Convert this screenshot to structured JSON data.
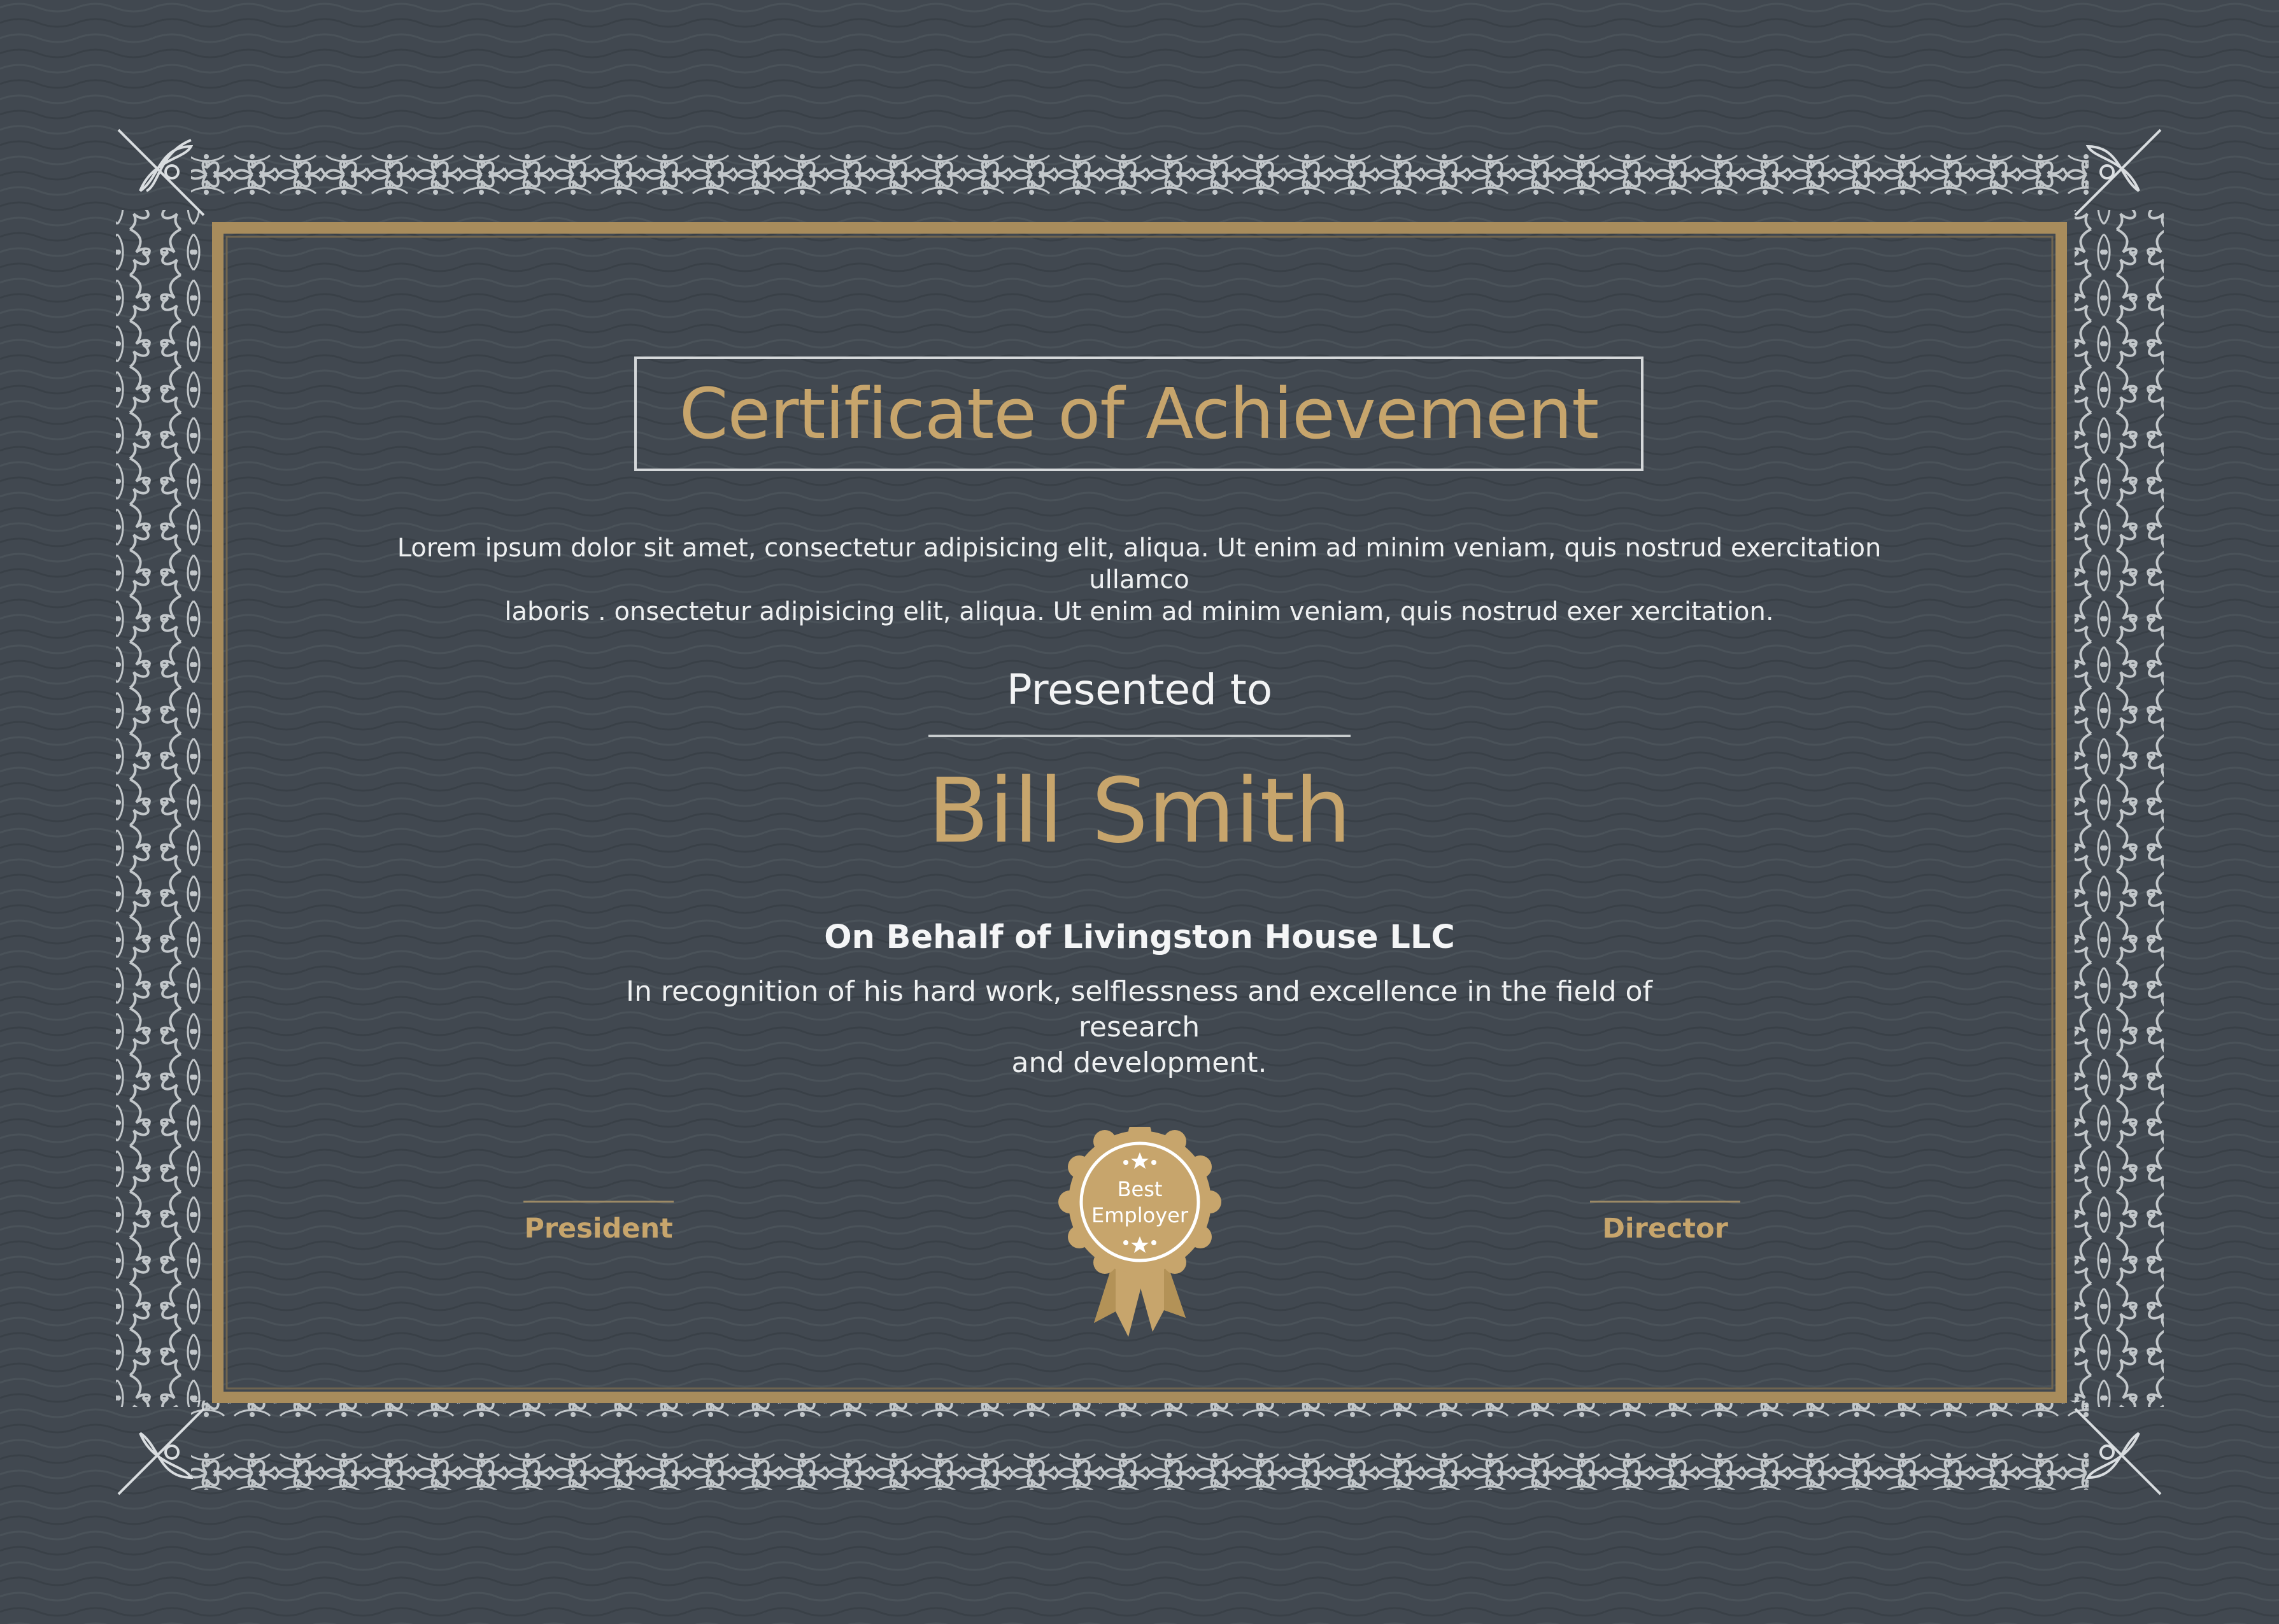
{
  "certificate": {
    "title": "Certificate of Achievement",
    "intro_line_1": "Lorem ipsum dolor sit amet, consectetur adipisicing elit,  aliqua. Ut enim ad minim veniam, quis nostrud exercitation ullamco",
    "intro_line_2": "laboris . onsectetur adipisicing elit,  aliqua. Ut enim ad minim veniam, quis nostrud exer xercitation.",
    "presented_label": "Presented to",
    "recipient_name": "Bill Smith",
    "organization": "On Behalf of Livingston House LLC",
    "recognition_line_1": "In recognition of his hard work, selflessness and excellence in the field of research",
    "recognition_line_2": "and development."
  },
  "signatures": {
    "left_label": "President",
    "right_label": "Director"
  },
  "seal": {
    "line_1": "Best",
    "line_2": "Employer",
    "icon": "award-ribbon-icon"
  },
  "colors": {
    "background": "#414850",
    "gold": "#c7a56c",
    "ornament": "#d9dde0",
    "text": "#eef0f1"
  }
}
